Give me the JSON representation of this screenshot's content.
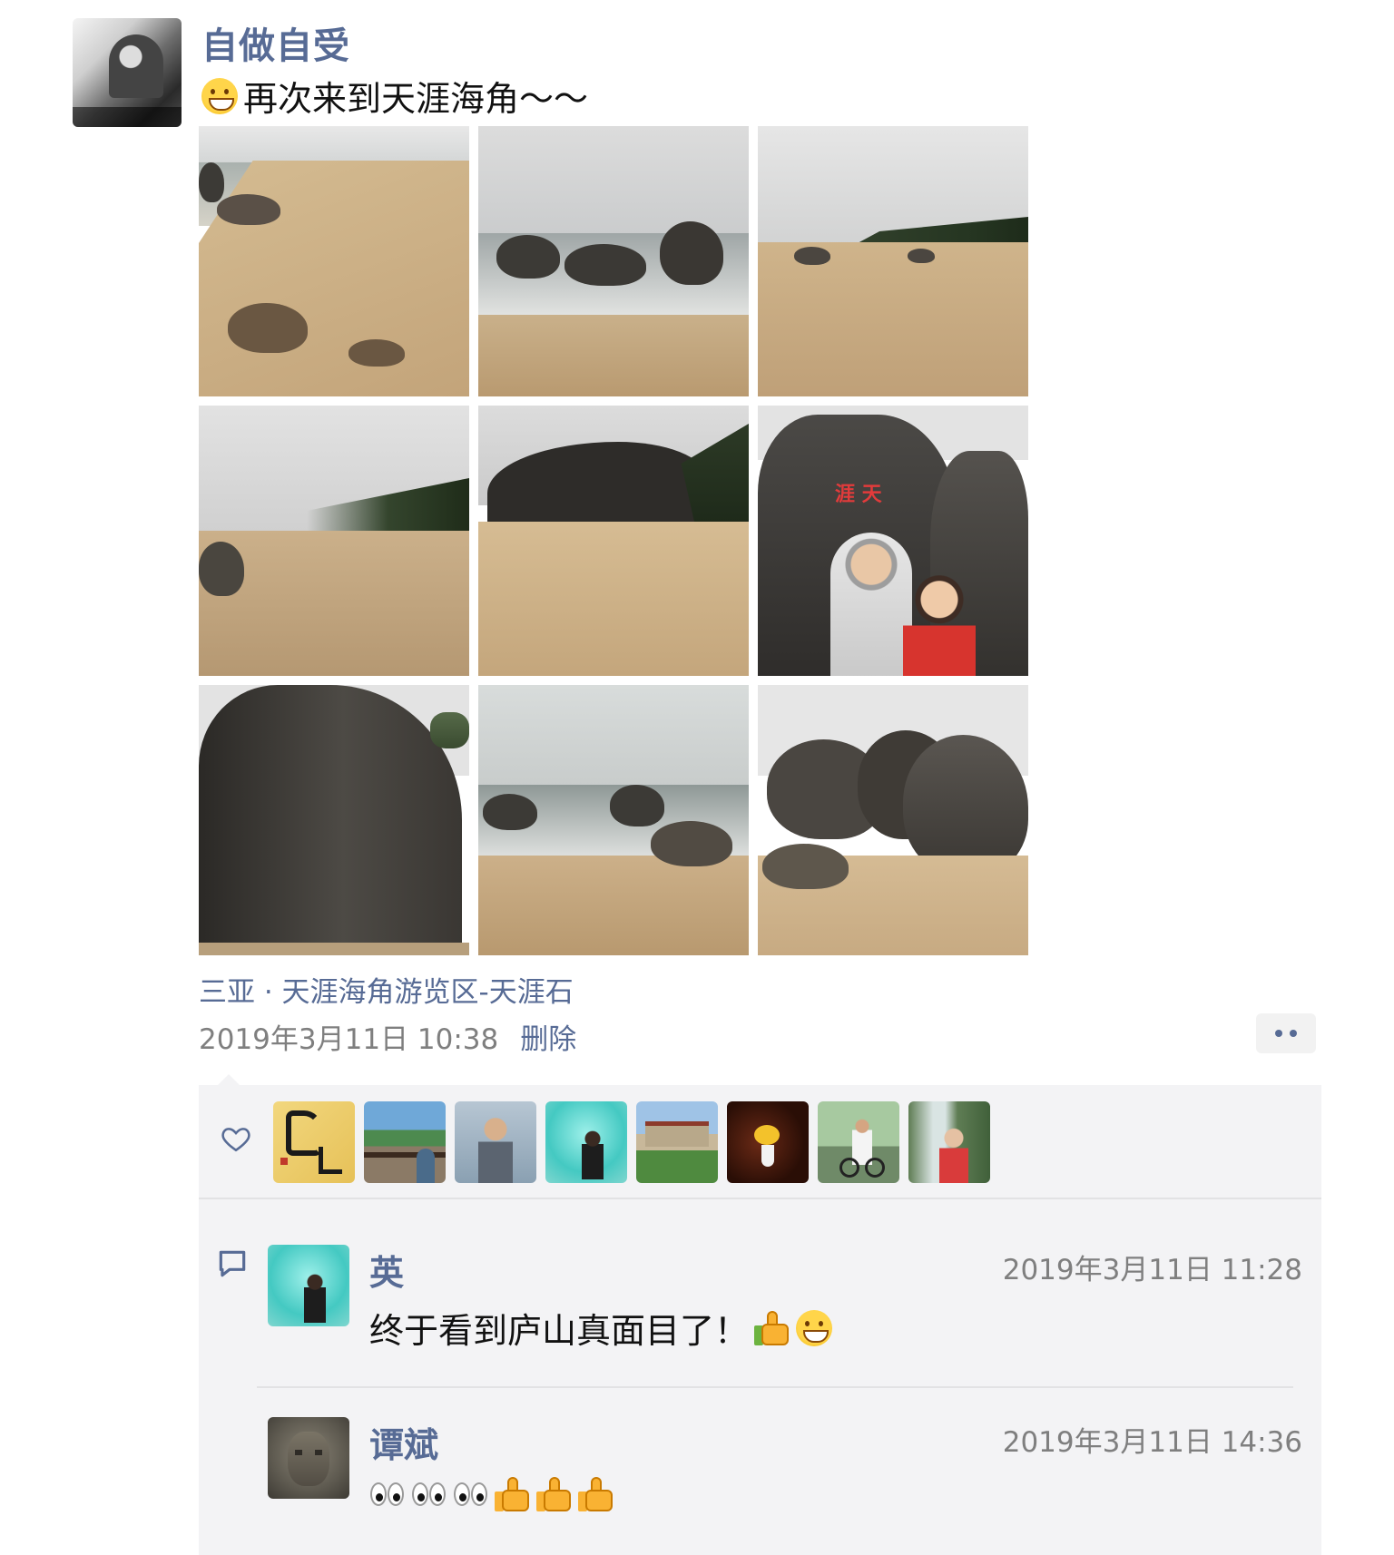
{
  "post": {
    "author": "自做自受",
    "text": "再次来到天涯海角～～",
    "text_emoji": "grinning-face-emoji",
    "photo_count": 9,
    "location": "三亚 · 天涯海角游览区-天涯石",
    "timestamp": "2019年3月11日 10:38",
    "delete_label": "删除",
    "more_icon": "more-dots-icon"
  },
  "likes": {
    "icon": "heart-icon",
    "avatar_count": 8
  },
  "comments": [
    {
      "name": "英",
      "time": "2019年3月11日 11:28",
      "text": "终于看到庐山真面目了！",
      "emojis": [
        "thumbs-up-emoji",
        "grinning-face-emoji"
      ]
    },
    {
      "name": "谭斌",
      "time": "2019年3月11日 14:36",
      "text": "",
      "emojis": [
        "eyes-emoji",
        "eyes-emoji",
        "eyes-emoji",
        "thumbs-up-emoji",
        "thumbs-up-emoji",
        "thumbs-up-emoji"
      ]
    }
  ],
  "colors": {
    "link": "#576b95",
    "meta": "#7f7f7f",
    "panel": "#f3f3f5"
  }
}
